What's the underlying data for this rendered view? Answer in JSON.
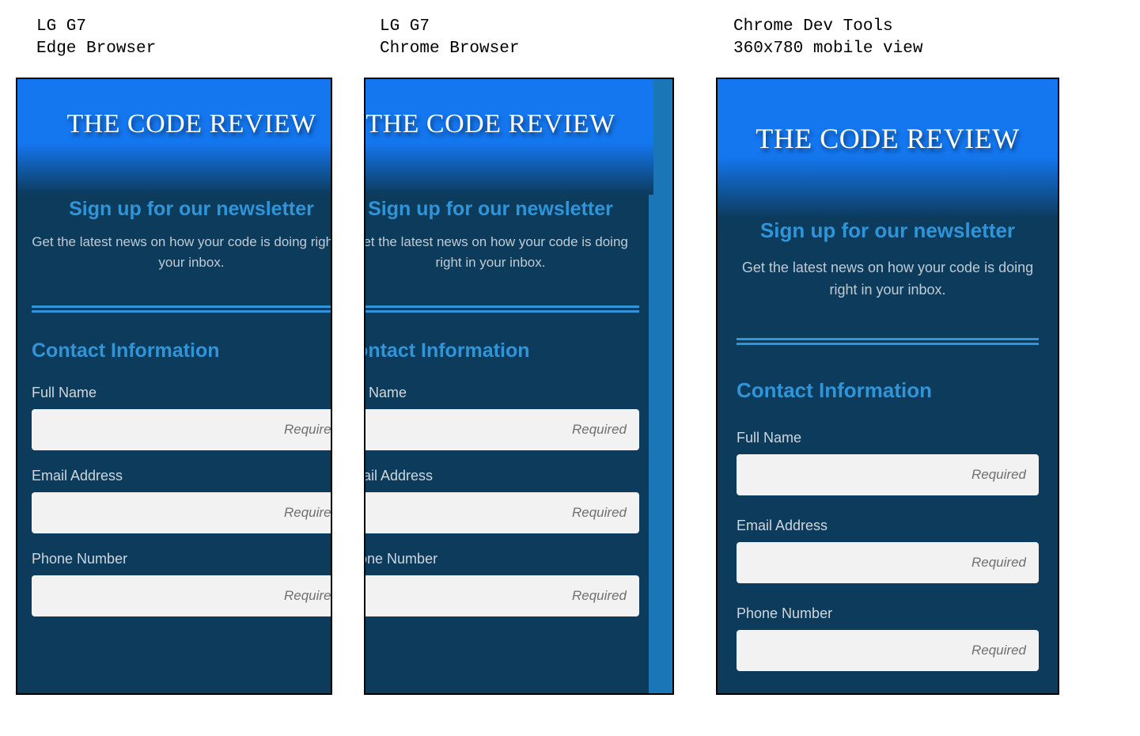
{
  "captions": {
    "m1": "LG G7\nEdge Browser",
    "m2": "LG G7\nChrome Browser",
    "m3": "Chrome Dev Tools\n360x780 mobile view"
  },
  "newsletter": {
    "title": "THE CODE REVIEW",
    "sub_heading": "Sign up for our newsletter",
    "tagline": "Get the latest news on how your code is doing right in your inbox.",
    "section_heading": "Contact Information",
    "fields": {
      "full_name": {
        "label": "Full Name",
        "placeholder": "Required"
      },
      "email": {
        "label": "Email Address",
        "placeholder": "Required"
      },
      "phone": {
        "label": "Phone Number",
        "placeholder": "Required"
      }
    }
  }
}
